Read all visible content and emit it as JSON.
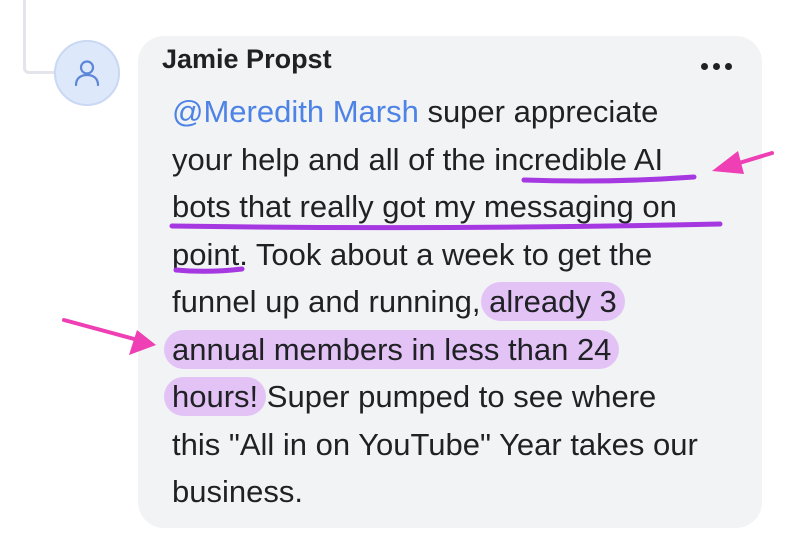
{
  "comment": {
    "author": "Jamie Propst",
    "more_icon": "more-horizontal-icon",
    "mention": "@Meredith Marsh",
    "lines": [
      " super appreciate",
      "your help and all of the incredible AI",
      "bots that really got my messaging on",
      "point. Took about a week to get the",
      "funnel up and running, ",
      "already 3",
      "annual members in less than 24",
      "hours!",
      " Super pumped to see where",
      "this \"All in on YouTube\" Year takes our",
      "business."
    ]
  },
  "annotations": {
    "underline_color": "#a538e0",
    "highlight_color": "#e3c3f6",
    "arrow_color": "#ee3fb4"
  }
}
